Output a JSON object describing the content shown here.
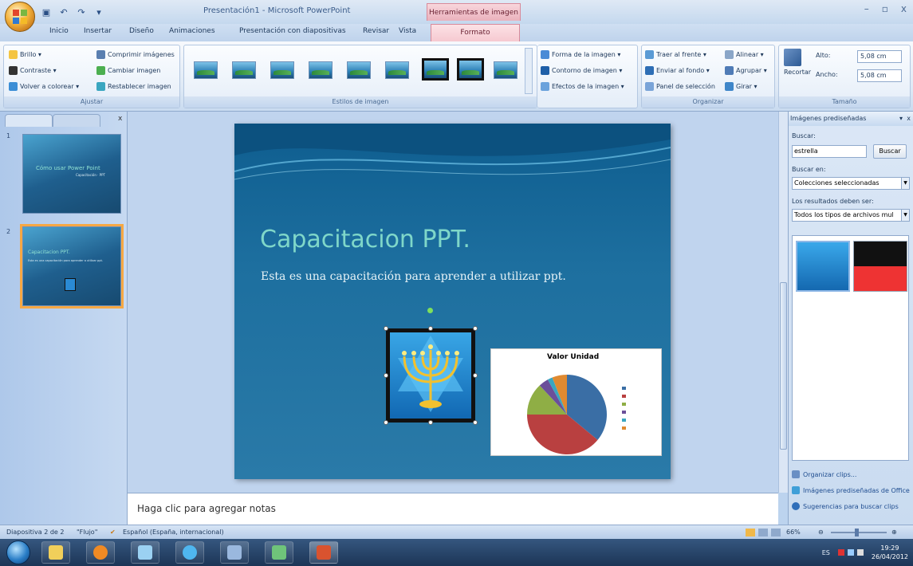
{
  "window": {
    "title": "Presentación1 - Microsoft PowerPoint",
    "context_tab_title": "Herramientas de imagen",
    "controls": [
      "–",
      "▫",
      "x"
    ]
  },
  "qat": {
    "icons": [
      "save-icon",
      "undo-icon",
      "redo-icon",
      "customize-icon"
    ]
  },
  "tabs": [
    "Inicio",
    "Insertar",
    "Diseño",
    "Animaciones",
    "Presentación con diapositivas",
    "Revisar",
    "Vista",
    "Formato"
  ],
  "ribbon": {
    "ajustar": {
      "label": "Ajustar",
      "brillo": "Brillo ▾",
      "contraste": "Contraste ▾",
      "volver_colorear": "Volver a colorear ▾",
      "comprimir": "Comprimir imágenes",
      "cambiar": "Cambiar imagen",
      "restablecer": "Restablecer imagen"
    },
    "estilos": {
      "label": "Estilos de imagen"
    },
    "forma": {
      "forma": "Forma de la imagen ▾",
      "contorno": "Contorno de imagen ▾",
      "efectos": "Efectos de la imagen ▾"
    },
    "organizar": {
      "label": "Organizar",
      "traer": "Traer al frente ▾",
      "enviar": "Enviar al fondo ▾",
      "panel": "Panel de selección",
      "alinear": "Alinear ▾",
      "agrupar": "Agrupar ▾",
      "girar": "Girar ▾"
    },
    "tamano": {
      "label": "Tamaño",
      "recortar": "Recortar",
      "alto_label": "Alto:",
      "alto_value": "5,08 cm",
      "ancho_label": "Ancho:",
      "ancho_value": "5,08 cm"
    }
  },
  "slides_pane": {
    "slide1": {
      "num": "1",
      "title": "Cómo usar Power Point",
      "subtitle": "Capacitación · PPT"
    },
    "slide2": {
      "num": "2",
      "title": "Capacitacion PPT.",
      "subtitle": "Esta es una capacitación para aprender a utilizar ppt."
    }
  },
  "slide": {
    "title": "Capacitacion PPT.",
    "subtitle": "Esta es una capacitación para aprender a utilizar ppt."
  },
  "notes": {
    "placeholder": "Haga clic para agregar notas"
  },
  "clip_pane": {
    "header": "Imágenes prediseñadas",
    "buscar_label": "Buscar:",
    "search_value": "estrella",
    "search_button": "Buscar",
    "buscar_en_label": "Buscar en:",
    "buscar_en_value": "Colecciones seleccionadas",
    "resultados_label": "Los resultados deben ser:",
    "resultados_value": "Todos los tipos de archivos mul",
    "links": [
      "Organizar clips...",
      "Imágenes prediseñadas de Office",
      "Sugerencias para buscar clips"
    ]
  },
  "status": {
    "slide_info": "Diapositiva 2 de 2",
    "theme": "\"Flujo\"",
    "language": "Español (España, internacional)",
    "zoom": "66%"
  },
  "taskbar": {
    "lang": "ES",
    "time": "19:29",
    "date": "26/04/2012"
  },
  "colors": {
    "accent": "#f6a844",
    "slide_title": "#7fd7c9",
    "context_tab": "#eab1bc"
  },
  "chart_data": {
    "type": "pie",
    "title": "Valor Unidad",
    "categories": [
      "",
      "",
      "",
      "",
      "",
      ""
    ],
    "values": [
      36,
      39,
      13,
      4,
      2,
      6
    ],
    "colors": [
      "#3a6ea5",
      "#b94040",
      "#8fae45",
      "#6b4f9a",
      "#3aa6c0",
      "#e08a30"
    ]
  }
}
